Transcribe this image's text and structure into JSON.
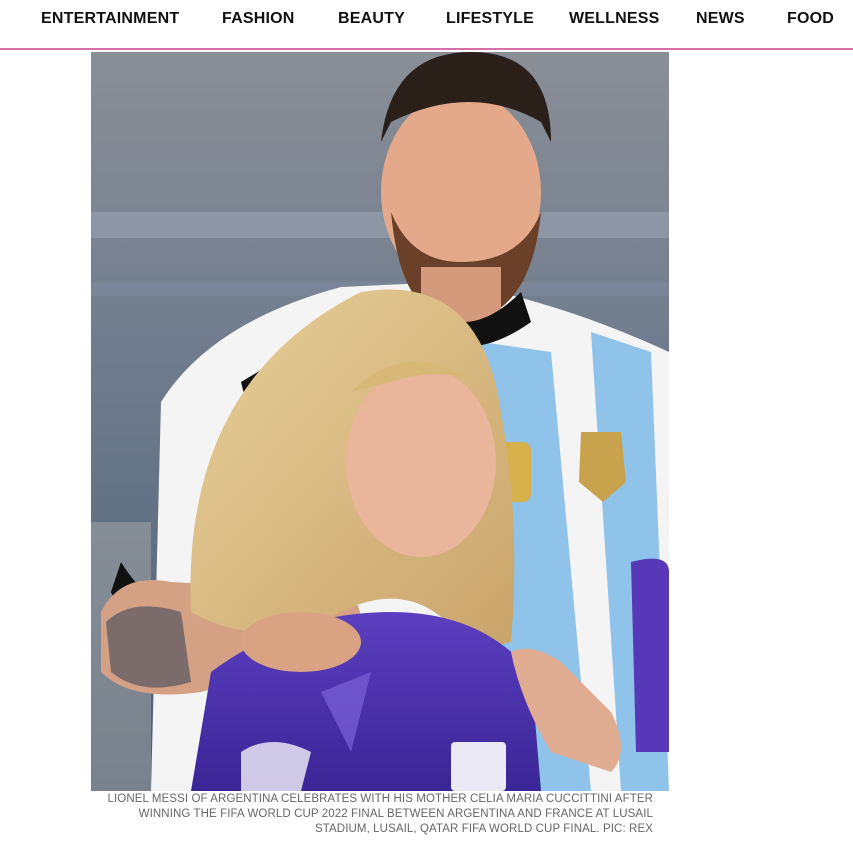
{
  "nav": {
    "items": [
      {
        "label": "ENTERTAINMENT"
      },
      {
        "label": "FASHION"
      },
      {
        "label": "BEAUTY"
      },
      {
        "label": "LIFESTYLE"
      },
      {
        "label": "WELLNESS"
      },
      {
        "label": "NEWS"
      },
      {
        "label": "FOOD"
      }
    ]
  },
  "article": {
    "photo": {
      "subject": "photo-messi-and-mother"
    },
    "caption": "LIONEL MESSI OF ARGENTINA CELEBRATES WITH HIS MOTHER CELIA MARIA CUCCITTINI AFTER WINNING THE FIFA WORLD CUP 2022 FINAL BETWEEN ARGENTINA AND FRANCE AT LUSAIL STADIUM, LUSAIL, QATAR FIFA WORLD CUP FINAL. PIC: REX"
  },
  "colors": {
    "nav_underline": "#d86fa6",
    "nav_text": "#111111",
    "caption_text": "#666666"
  }
}
